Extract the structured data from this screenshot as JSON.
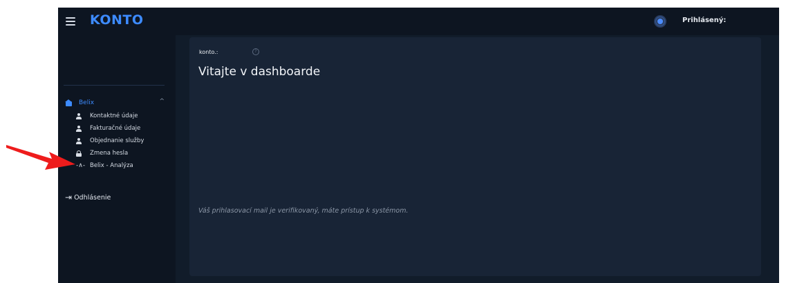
{
  "header": {
    "logo": "KONTO",
    "user_label": "Prihlásený:"
  },
  "sidebar": {
    "group": {
      "label": "Belix",
      "icon": "home-icon",
      "expanded": true
    },
    "items": [
      {
        "label": "Kontaktné údaje",
        "icon": "person-icon"
      },
      {
        "label": "Fakturačné údaje",
        "icon": "person-icon"
      },
      {
        "label": "Objednanie služby",
        "icon": "person-icon"
      },
      {
        "label": "Zmena hesla",
        "icon": "lock-icon"
      },
      {
        "label": "Belix - Analýza",
        "icon": "pulse-icon"
      }
    ],
    "logout": {
      "label": "Odhlásenie",
      "icon": "logout-icon"
    }
  },
  "main": {
    "konto_label": "konto.:",
    "title": "Vitajte v dashboarde",
    "message": "Váš prihlasovací mail je verifikovaný, máte prístup k systémom."
  },
  "annotation": {
    "type": "arrow",
    "color": "#ee1c1c"
  },
  "colors": {
    "accent": "#3d8bff",
    "background": "#111c2a",
    "card": "#182436"
  }
}
